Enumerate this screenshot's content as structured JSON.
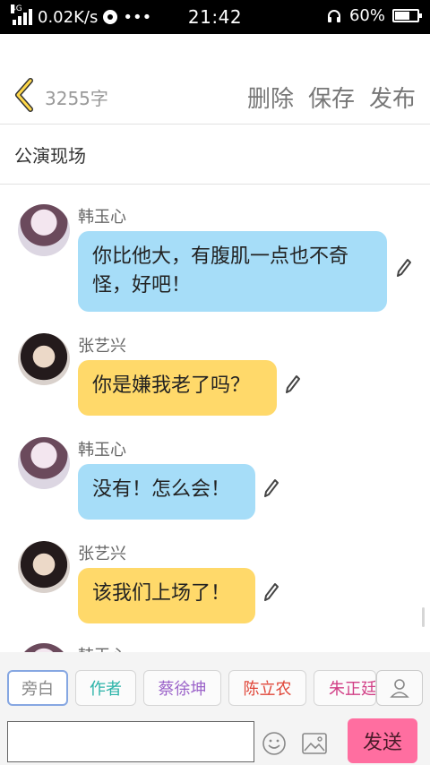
{
  "status_bar": {
    "network_type": "4G",
    "speed": "0.02K/s",
    "extra": "•••",
    "time": "21:42",
    "battery": "60%",
    "battery_level": 0.6
  },
  "header": {
    "word_count": "3255字",
    "delete_label": "删除",
    "save_label": "保存",
    "publish_label": "发布"
  },
  "title": "公演现场",
  "messages": [
    {
      "speaker": "韩玉心",
      "text_lines": [
        "你比他大，有腹肌一点也不奇",
        "怪，好吧！"
      ],
      "color": "#a6ddf8"
    },
    {
      "speaker": "张艺兴",
      "text_lines": [
        "你是嫌我老了吗？"
      ],
      "color": "#ffd96a"
    },
    {
      "speaker": "韩玉心",
      "text_lines": [
        "没有！怎么会！"
      ],
      "color": "#a6ddf8"
    },
    {
      "speaker": "张艺兴",
      "text_lines": [
        "该我们上场了！"
      ],
      "color": "#ffd96a"
    },
    {
      "speaker": "韩玉心"
    }
  ],
  "characters": [
    {
      "label": "旁白",
      "color": "#888888",
      "selected": true
    },
    {
      "label": "作者",
      "color": "#2bb3a8"
    },
    {
      "label": "蔡徐坤",
      "color": "#9b63c9"
    },
    {
      "label": "陈立农",
      "color": "#e0473a"
    },
    {
      "label": "朱正廷",
      "color": "#d13f86"
    }
  ],
  "input": {
    "value": "",
    "send_label": "发送"
  }
}
